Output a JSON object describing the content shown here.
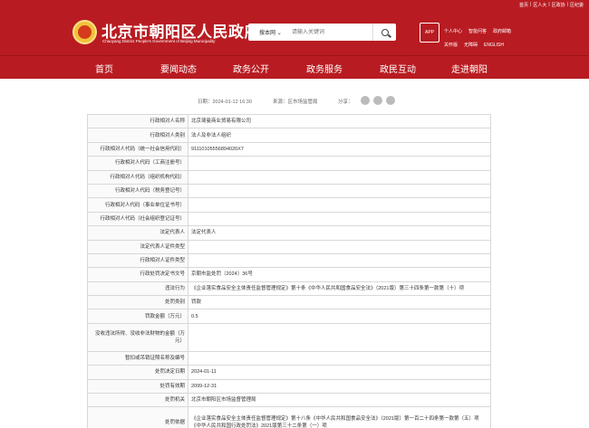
{
  "top_links": [
    "首页",
    "|",
    "区人大",
    "|",
    "区政协",
    "|",
    "区纪委"
  ],
  "site": {
    "title": "北京市朝阳区人民政府",
    "subtitle": "Chaoyang District People's Government of Beijing Municipality"
  },
  "search": {
    "scope": "搜本网",
    "placeholder": "请输入关键词"
  },
  "app_badge": "APP",
  "quick_links": {
    "row1": [
      "个人中心",
      "智能问答",
      "政府邮箱"
    ],
    "row2": [
      "关怀版",
      "无障碍",
      "ENGLISH"
    ]
  },
  "nav": [
    "首页",
    "要闻动态",
    "政务公开",
    "政务服务",
    "政民互动",
    "走进朝阳"
  ],
  "meta": {
    "date": "日期：2024-01-12 16:30",
    "source": "来源：区市场监管局",
    "share_label": "分享："
  },
  "table_rows": [
    {
      "label": "行政相对人名称",
      "value": "北京琦曼商业贸易有限公司"
    },
    {
      "label": "行政相对人类别",
      "value": "法人及非法人组织"
    },
    {
      "label": "行政相对人代码（统一社会信用代码）",
      "value": "91110105556894026X7"
    },
    {
      "label": "行政相对人代码（工商注册号）",
      "value": ""
    },
    {
      "label": "行政相对人代码（组织机构代码）",
      "value": ""
    },
    {
      "label": "行政相对人代码（税务登记号）",
      "value": ""
    },
    {
      "label": "行政相对人代码（事业单位证书号）",
      "value": ""
    },
    {
      "label": "行政相对人代码（社会组织登记证号）",
      "value": ""
    },
    {
      "label": "法定代表人",
      "value": "法定代表人"
    },
    {
      "label": "法定代表人证件类型",
      "value": ""
    },
    {
      "label": "行政相对人证件类型",
      "value": ""
    },
    {
      "label": "行政处罚决定书文号",
      "value": "京朝市监处罚〔2024〕36号"
    },
    {
      "label": "违法行为",
      "value": "《企业落实食品安全主体责任监督管理规定》第十条《中华人民共和国食品安全法》（2021版）第三十四条第一款第（十）项"
    },
    {
      "label": "处罚类别",
      "value": "罚款"
    },
    {
      "label": "罚款金额（万元）",
      "value": "0.5"
    },
    {
      "label": "没收违法所得、没收非法财物的金额（万元）",
      "value": "",
      "tall": true
    },
    {
      "label": "暂扣或吊销证照名称及编号",
      "value": ""
    },
    {
      "label": "处罚决定日期",
      "value": "2024-01-11"
    },
    {
      "label": "处罚有效期",
      "value": "2099-12-31"
    },
    {
      "label": "处罚机关",
      "value": "北京市朝阳区市场监督管理局"
    },
    {
      "label": "处罚依据",
      "value": "《企业落实食品安全主体责任监督管理规定》第十八条《中华人民共和国食品安全法》（2021版）第一百二十四条第一款第（五）项《中华人民共和国行政处罚法》2021版第三十二条第（一）项",
      "tall2": true
    }
  ]
}
